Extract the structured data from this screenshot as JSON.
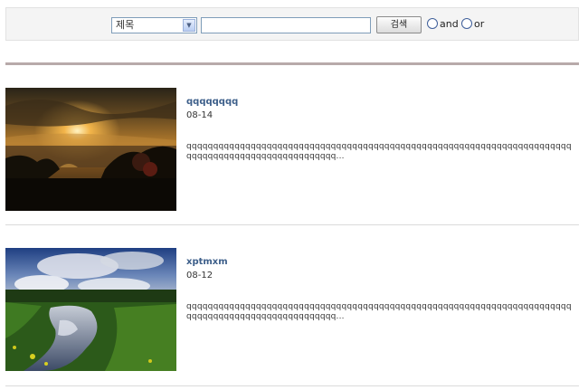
{
  "search": {
    "field_select": "제목",
    "query_value": "",
    "button_label": "검색",
    "radio_and": "and",
    "radio_or": "or"
  },
  "posts": [
    {
      "title": "qqqqqqqq",
      "date": "08-14",
      "excerpt": "qqqqqqqqqqqqqqqqqqqqqqqqqqqqqqqqqqqqqqqqqqqqqqqqqqqqqqqqqqqqqqqqqqqqqqqqqqqqqqqqqqqqqqqqqqqqqqqqqqqq...",
      "image": "sunset-over-water-photo"
    },
    {
      "title": "xptmxm",
      "date": "08-12",
      "excerpt": "qqqqqqqqqqqqqqqqqqqqqqqqqqqqqqqqqqqqqqqqqqqqqqqqqqqqqqqqqqqqqqqqqqqqqqqqqqqqqqqqqqqqqqqqqqqqqqqqqqqq...",
      "image": "river-clouds-landscape-photo"
    }
  ],
  "colors": {
    "title_link": "#3d5f8a",
    "rule": "#b8aaaa"
  }
}
